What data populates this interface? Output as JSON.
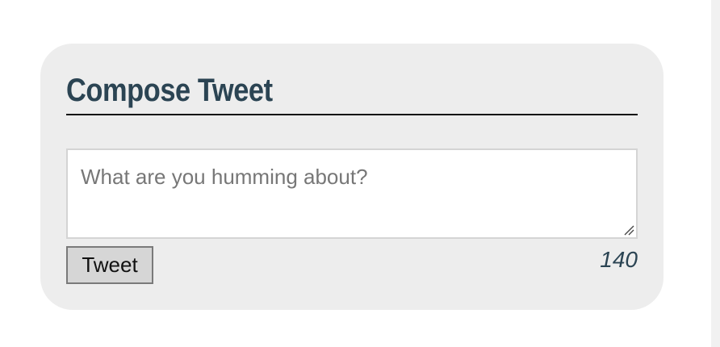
{
  "compose": {
    "title": "Compose Tweet",
    "textarea_placeholder": "What are you humming about?",
    "textarea_value": "",
    "submit_label": "Tweet",
    "char_count": "140"
  },
  "colors": {
    "card_background": "#ededed",
    "title_color": "#2b4453",
    "button_background": "#d6d6d6"
  },
  "icons": {
    "resize": "resize-handle-icon"
  }
}
